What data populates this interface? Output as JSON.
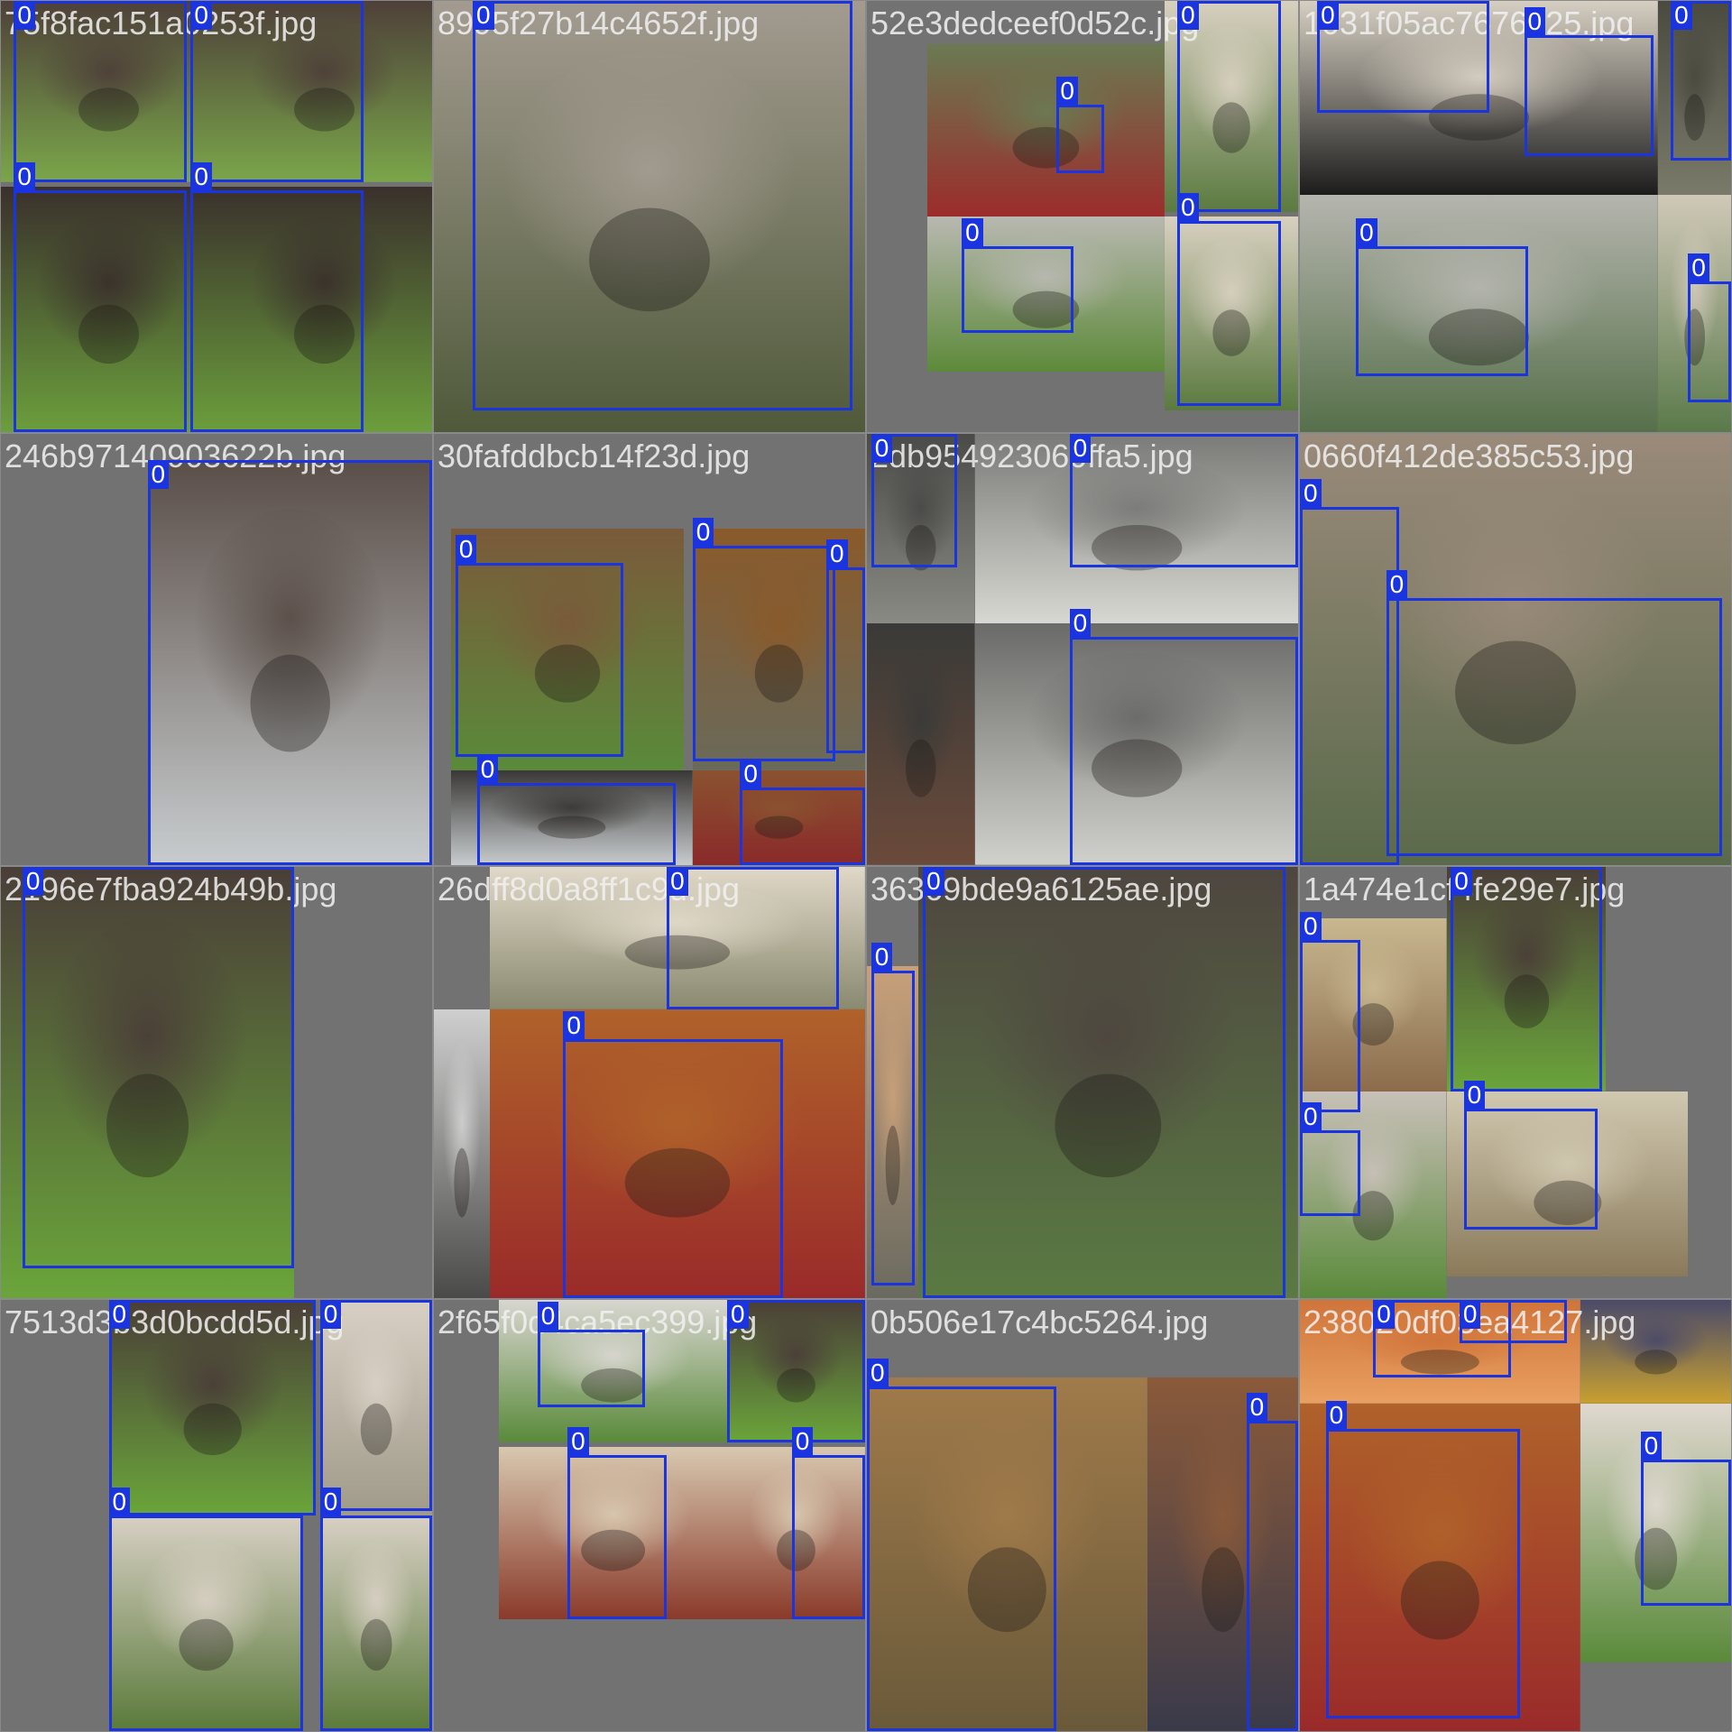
{
  "label_class": "0",
  "box_color": "#1a35e0",
  "tiles": [
    {
      "file": "75f8fac151a0253f.jpg",
      "photos": [
        [
          0,
          0,
          0.5,
          0.42,
          "#4e4039",
          "#7aa64a"
        ],
        [
          0.5,
          0,
          0.5,
          0.42,
          "#4e4039",
          "#7aa64a"
        ],
        [
          0,
          0.43,
          0.5,
          0.57,
          "#3a302c",
          "#6b9e3c"
        ],
        [
          0.5,
          0.43,
          0.5,
          0.57,
          "#3a302c",
          "#6b9e3c"
        ]
      ],
      "boxes": [
        [
          0.03,
          0,
          0.4,
          0.42
        ],
        [
          0.44,
          0,
          0.4,
          0.42
        ],
        [
          0.03,
          0.44,
          0.4,
          0.56
        ],
        [
          0.44,
          0.44,
          0.4,
          0.56
        ]
      ]
    },
    {
      "file": "8995f27b14c4652f.jpg",
      "photos": [
        [
          0,
          0,
          1,
          1,
          "#a39b90",
          "#4f5a3a"
        ]
      ],
      "boxes": [
        [
          0.09,
          0,
          0.88,
          0.95
        ]
      ]
    },
    {
      "file": "52e3dedceef0d52c.jpg",
      "photos": [
        [
          0.14,
          0.1,
          0.55,
          0.4,
          "#6a7a52",
          "#9c2c2c"
        ],
        [
          0.14,
          0.5,
          0.55,
          0.36,
          "#b8b8b0",
          "#5d8a3a"
        ],
        [
          0.69,
          0,
          0.31,
          0.49,
          "#d8d0c0",
          "#5b7a40"
        ],
        [
          0.69,
          0.5,
          0.31,
          0.45,
          "#d8d0c0",
          "#5b7a40"
        ]
      ],
      "boxes": [
        [
          0.44,
          0.24,
          0.11,
          0.16
        ],
        [
          0.22,
          0.57,
          0.26,
          0.2
        ],
        [
          0.72,
          0,
          0.24,
          0.49
        ],
        [
          0.72,
          0.51,
          0.24,
          0.43
        ]
      ]
    },
    {
      "file": "1031f05ac7676a25.jpg",
      "photos": [
        [
          0,
          0,
          0.83,
          0.45,
          "#d6cfc2",
          "#1c1c1c"
        ],
        [
          0.83,
          0,
          0.17,
          0.45,
          "#4a4a40",
          "#7a7a6a"
        ],
        [
          0,
          0.45,
          0.83,
          0.55,
          "#b5b5ae",
          "#56704a"
        ],
        [
          0.83,
          0.45,
          0.17,
          0.55,
          "#d0c8b8",
          "#5a7a4a"
        ]
      ],
      "boxes": [
        [
          0.04,
          0,
          0.4,
          0.26
        ],
        [
          0.52,
          0.08,
          0.3,
          0.28
        ],
        [
          0.86,
          0,
          0.14,
          0.37
        ],
        [
          0.13,
          0.57,
          0.4,
          0.3
        ],
        [
          0.9,
          0.65,
          0.1,
          0.28
        ]
      ]
    },
    {
      "file": "246b97140903622b.jpg",
      "photos": [
        [
          0.34,
          0.06,
          0.66,
          0.94,
          "#5a4e48",
          "#c8ccce"
        ]
      ],
      "boxes": [
        [
          0.34,
          0.06,
          0.66,
          0.94
        ]
      ]
    },
    {
      "file": "30fafddbcb14f23d.jpg",
      "photos": [
        [
          0.04,
          0.22,
          0.54,
          0.56,
          "#7a5a3a",
          "#5a8a3a"
        ],
        [
          0.6,
          0.22,
          0.4,
          0.56,
          "#8a5a2a",
          "#6a6a5a"
        ],
        [
          0.04,
          0.78,
          0.56,
          0.22,
          "#3a3836",
          "#c8ccce"
        ],
        [
          0.6,
          0.78,
          0.4,
          0.22,
          "#8a5230",
          "#8a2a2a"
        ]
      ],
      "boxes": [
        [
          0.05,
          0.3,
          0.39,
          0.45
        ],
        [
          0.6,
          0.26,
          0.33,
          0.5
        ],
        [
          0.91,
          0.31,
          0.09,
          0.43
        ],
        [
          0.1,
          0.81,
          0.46,
          0.19
        ],
        [
          0.71,
          0.82,
          0.29,
          0.18
        ]
      ]
    },
    {
      "file": "2db954923060ffa5.jpg",
      "photos": [
        [
          0,
          0,
          0.25,
          0.44,
          "#4a4a48",
          "#8a8a84"
        ],
        [
          0.25,
          0,
          0.75,
          0.44,
          "#7a7a78",
          "#d8d8d2"
        ],
        [
          0,
          0.44,
          0.25,
          0.56,
          "#3a3a38",
          "#6a4a3a"
        ],
        [
          0.25,
          0.44,
          0.75,
          0.56,
          "#6a6a68",
          "#d0d0cc"
        ]
      ],
      "boxes": [
        [
          0.01,
          0,
          0.2,
          0.31
        ],
        [
          0.47,
          0,
          0.53,
          0.31
        ],
        [
          0.47,
          0.47,
          0.53,
          0.53
        ]
      ]
    },
    {
      "file": "0660f412de385c53.jpg",
      "photos": [
        [
          0,
          0,
          1,
          1,
          "#9a8a7a",
          "#5a6a4a"
        ]
      ],
      "boxes": [
        [
          0,
          0.17,
          0.23,
          0.83
        ],
        [
          0.2,
          0.38,
          0.78,
          0.6
        ]
      ]
    },
    {
      "file": "2196e7fba924b49b.jpg",
      "photos": [
        [
          0,
          0,
          0.68,
          1,
          "#4a3e38",
          "#6aa53a"
        ]
      ],
      "boxes": [
        [
          0.05,
          0,
          0.63,
          0.93
        ]
      ]
    },
    {
      "file": "26dff8d0a8ff1c9d.jpg",
      "photos": [
        [
          0.13,
          0,
          0.87,
          0.33,
          "#e0d8c8",
          "#8a8a70"
        ],
        [
          0,
          0.33,
          0.13,
          0.67,
          "#cfcfcf",
          "#4a4a48"
        ],
        [
          0.13,
          0.33,
          0.87,
          0.67,
          "#b0622a",
          "#9a2a2a"
        ]
      ],
      "boxes": [
        [
          0.54,
          0,
          0.4,
          0.33
        ],
        [
          0.3,
          0.4,
          0.51,
          0.6
        ]
      ]
    },
    {
      "file": "36369bde9a6125ae.jpg",
      "photos": [
        [
          0,
          0.23,
          0.12,
          0.77,
          "#c8a07a",
          "#6a6a60"
        ],
        [
          0.12,
          0,
          0.88,
          1,
          "#4e4640",
          "#5a7a42"
        ]
      ],
      "boxes": [
        [
          0.01,
          0.24,
          0.1,
          0.73
        ],
        [
          0.13,
          0,
          0.84,
          1
        ]
      ]
    },
    {
      "file": "1a474e1cf4fe29e7.jpg",
      "photos": [
        [
          0,
          0.12,
          0.34,
          0.41,
          "#c8b890",
          "#8a6a4a"
        ],
        [
          0.34,
          0,
          0.37,
          0.52,
          "#4a3e38",
          "#6aa53a"
        ],
        [
          0,
          0.52,
          0.34,
          0.48,
          "#c8c0b8",
          "#5a8a3a"
        ],
        [
          0.34,
          0.52,
          0.56,
          0.43,
          "#d0c8b0",
          "#8a7a5a"
        ]
      ],
      "boxes": [
        [
          0,
          0.17,
          0.14,
          0.4
        ],
        [
          0.35,
          0,
          0.35,
          0.52
        ],
        [
          0,
          0.61,
          0.14,
          0.2
        ],
        [
          0.38,
          0.56,
          0.31,
          0.28
        ]
      ]
    },
    {
      "file": "7513d3b3d0bcdd5d.jpg",
      "photos": [
        [
          0.25,
          0,
          0.48,
          0.5,
          "#4a3e38",
          "#6aa53a"
        ],
        [
          0.74,
          0,
          0.26,
          0.5,
          "#d8d0c4",
          "#a09a8a"
        ],
        [
          0.25,
          0.5,
          0.45,
          0.5,
          "#d8d0c4",
          "#5a7a3a"
        ],
        [
          0.74,
          0.5,
          0.26,
          0.5,
          "#d8d0c4",
          "#5a7a3a"
        ]
      ],
      "boxes": [
        [
          0.25,
          0,
          0.48,
          0.5
        ],
        [
          0.74,
          0,
          0.26,
          0.49
        ],
        [
          0.25,
          0.5,
          0.45,
          0.5
        ],
        [
          0.74,
          0.5,
          0.26,
          0.5
        ]
      ]
    },
    {
      "file": "2f65f0d4ca5ec399.jpg",
      "photos": [
        [
          0.15,
          0,
          0.53,
          0.33,
          "#d8d6d0",
          "#5a8a3a"
        ],
        [
          0.68,
          0,
          0.32,
          0.33,
          "#4a3e38",
          "#6aa53a"
        ],
        [
          0.15,
          0.34,
          0.53,
          0.4,
          "#d8c8b0",
          "#8a3a2a"
        ],
        [
          0.68,
          0.34,
          0.32,
          0.4,
          "#d8c8b0",
          "#8a3a2a"
        ]
      ],
      "boxes": [
        [
          0.24,
          0.07,
          0.25,
          0.18
        ],
        [
          0.68,
          0,
          0.32,
          0.33
        ],
        [
          0.31,
          0.36,
          0.23,
          0.38
        ],
        [
          0.83,
          0.36,
          0.17,
          0.38
        ]
      ]
    },
    {
      "file": "0b506e17c4bc5264.jpg",
      "photos": [
        [
          0,
          0.18,
          0.65,
          0.82,
          "#a07a4a",
          "#6a5a3a"
        ],
        [
          0.65,
          0.18,
          0.35,
          0.82,
          "#8a5a3a",
          "#3a3a4a"
        ]
      ],
      "boxes": [
        [
          0,
          0.2,
          0.44,
          0.8
        ],
        [
          0.88,
          0.28,
          0.12,
          0.72
        ]
      ]
    },
    {
      "file": "238020df03ea4127.jpg",
      "photos": [
        [
          0,
          0,
          0.65,
          0.24,
          "#d0743a",
          "#e8a060"
        ],
        [
          0.65,
          0,
          0.35,
          0.24,
          "#4a4a6a",
          "#c8a030"
        ],
        [
          0,
          0.24,
          0.65,
          0.76,
          "#b0622a",
          "#9a2a2a"
        ],
        [
          0.65,
          0.24,
          0.35,
          0.6,
          "#e0d8d0",
          "#5a8a3a"
        ]
      ],
      "boxes": [
        [
          0.17,
          0,
          0.32,
          0.18
        ],
        [
          0.37,
          0,
          0.25,
          0.1
        ],
        [
          0.06,
          0.3,
          0.45,
          0.67
        ],
        [
          0.79,
          0.37,
          0.21,
          0.34
        ]
      ]
    }
  ]
}
